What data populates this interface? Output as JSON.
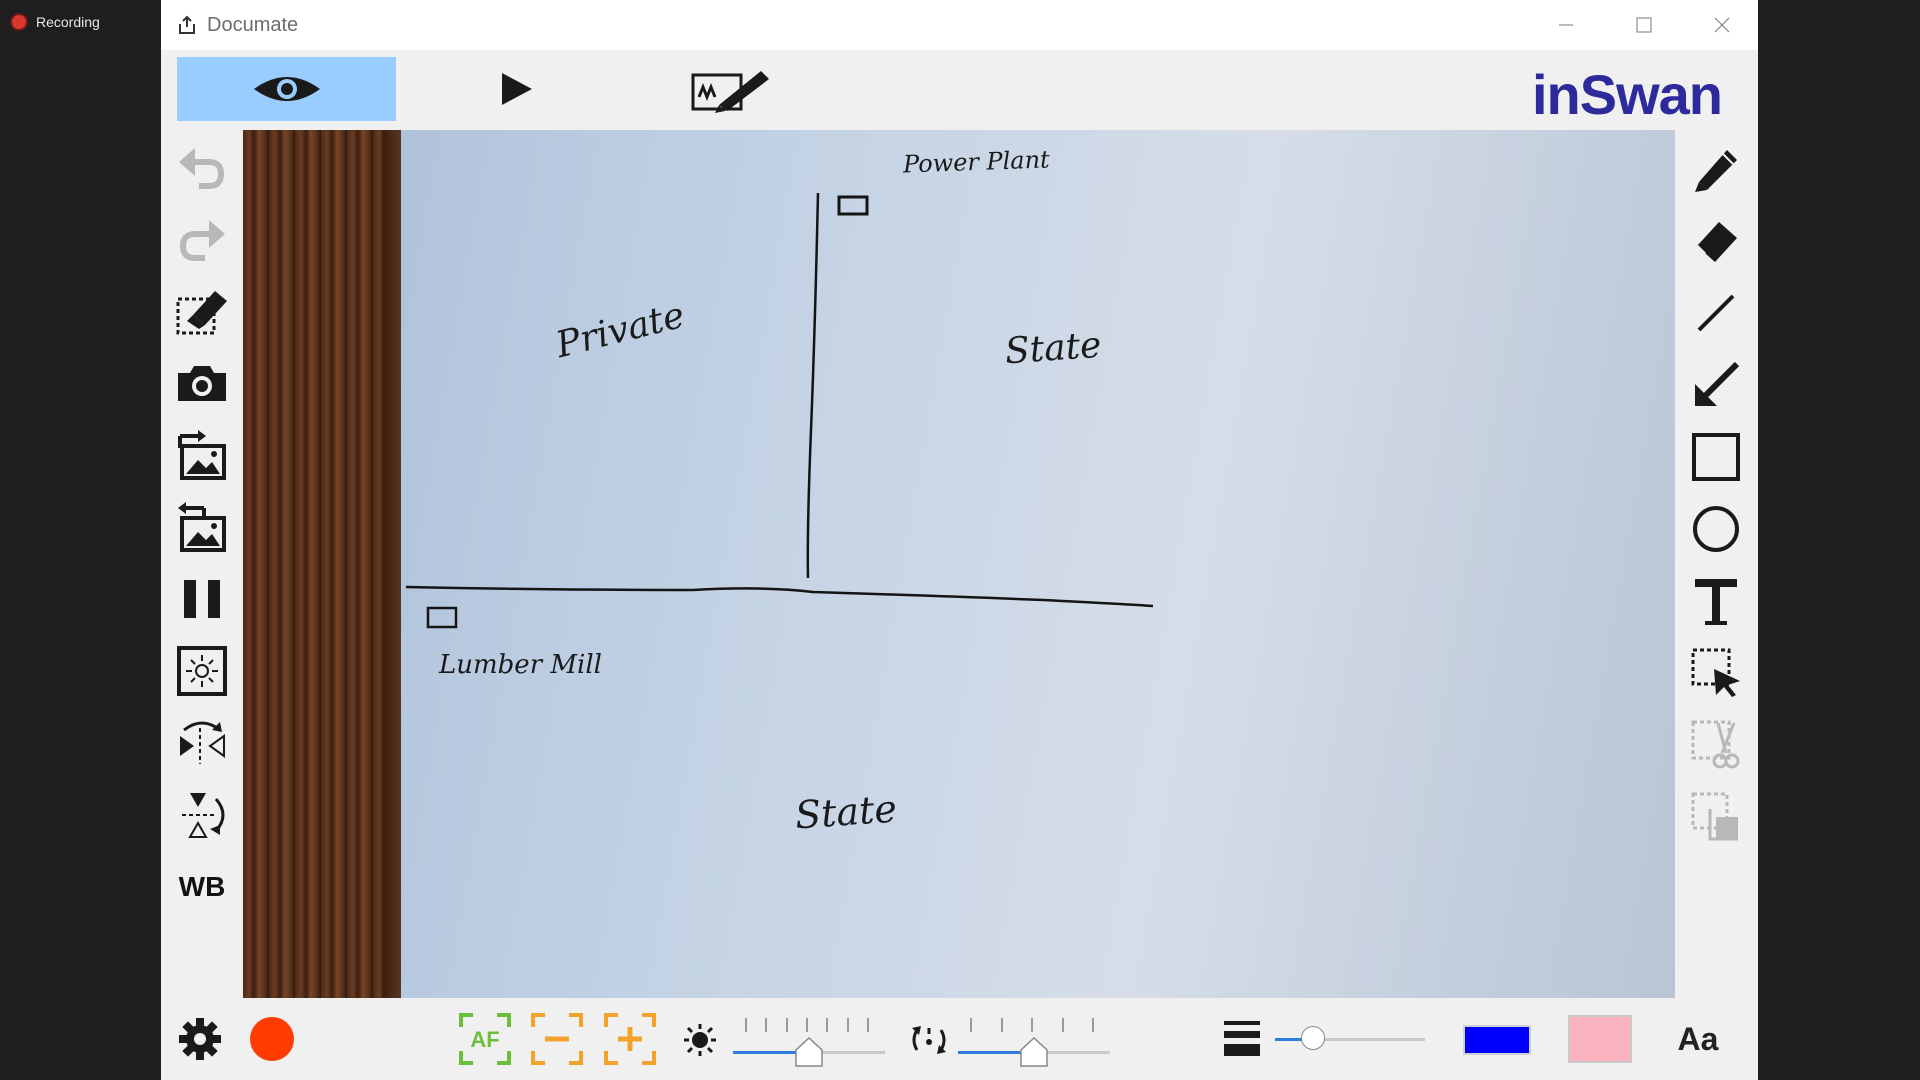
{
  "taskbar": {
    "recording_label": "Recording"
  },
  "window": {
    "title": "Documate",
    "brand": "inSwan"
  },
  "toolbar": {
    "items": [
      {
        "name": "live-view",
        "icon": "eye-icon",
        "active": true
      },
      {
        "name": "play",
        "icon": "play-icon",
        "active": false
      },
      {
        "name": "annotate",
        "icon": "signature-pen-icon",
        "active": false
      }
    ]
  },
  "left_tools": [
    {
      "name": "undo",
      "icon": "undo-icon"
    },
    {
      "name": "redo",
      "icon": "redo-icon"
    },
    {
      "name": "clear-drawing",
      "icon": "erase-selection-icon"
    },
    {
      "name": "capture",
      "icon": "camera-icon"
    },
    {
      "name": "import-image",
      "icon": "image-import-icon"
    },
    {
      "name": "export-image",
      "icon": "image-export-icon"
    },
    {
      "name": "freeze",
      "icon": "pause-icon"
    },
    {
      "name": "auto-exposure",
      "icon": "exposure-icon"
    },
    {
      "name": "mirror",
      "icon": "mirror-icon"
    },
    {
      "name": "flip",
      "icon": "flip-icon"
    },
    {
      "name": "white-balance",
      "icon": "wb-text",
      "label": "WB"
    }
  ],
  "canvas": {
    "labels": {
      "power_plant": "Power Plant",
      "private": "Private",
      "state_right": "State",
      "lumber_mill": "Lumber Mill",
      "state_bottom": "State"
    }
  },
  "right_tools": [
    {
      "name": "pen",
      "icon": "pen-icon"
    },
    {
      "name": "eraser",
      "icon": "eraser-icon"
    },
    {
      "name": "line",
      "icon": "line-icon"
    },
    {
      "name": "arrow",
      "icon": "arrow-icon"
    },
    {
      "name": "rectangle",
      "icon": "rectangle-icon"
    },
    {
      "name": "ellipse",
      "icon": "circle-icon"
    },
    {
      "name": "text",
      "icon": "text-icon"
    },
    {
      "name": "select",
      "icon": "select-icon"
    },
    {
      "name": "cut",
      "icon": "scissors-icon",
      "disabled": true
    },
    {
      "name": "copy",
      "icon": "copy-icon",
      "disabled": true
    }
  ],
  "bottom": {
    "af_label": "AF",
    "brightness_level": 0.5,
    "rotation_level": 0.5,
    "line_width_level": 0.25,
    "stroke_color": "#0000ff",
    "fill_color": "#f9b2be",
    "font_label": "Aa",
    "record_color": "#ff3b00"
  }
}
